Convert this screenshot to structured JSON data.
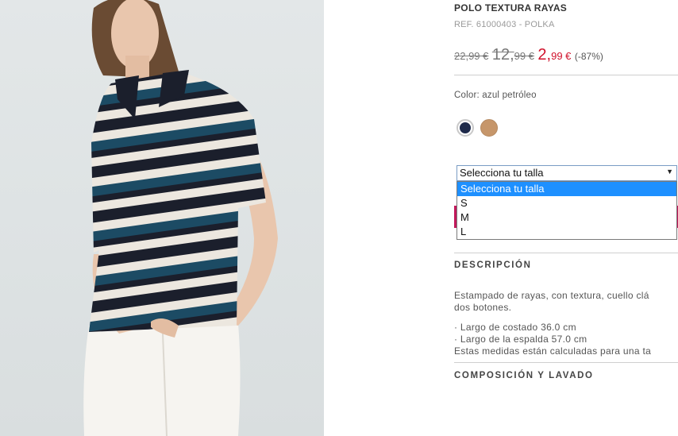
{
  "product": {
    "title": "POLO TEXTURA RAYAS",
    "ref": "REF. 61000403 - POLKA"
  },
  "price": {
    "original": "22,99 €",
    "previous_int": "12,",
    "previous_dec": "99 €",
    "current_int": "2,",
    "current_dec": "99 €",
    "discount": "(-87%)",
    "sale_color": "#d0112b"
  },
  "color": {
    "label": "Color: azul petróleo",
    "swatches": [
      {
        "name": "navy",
        "hex": "#1e2a4a",
        "selected": true
      },
      {
        "name": "camel",
        "hex": "#c6966a",
        "selected": false
      }
    ]
  },
  "size": {
    "selected_value": "Selecciona tu talla",
    "options": [
      "Selecciona tu talla",
      "S",
      "M",
      "L"
    ]
  },
  "description": {
    "title": "DESCRIPCIÓN",
    "text_line1": "Estampado de rayas, con textura, cuello clá",
    "text_line2": "dos botones.",
    "measure1": "· Largo de costado 36.0 cm",
    "measure2": "· Largo de la espalda 57.0 cm",
    "measure_note": "Estas medidas están calculadas para una ta"
  },
  "composition": {
    "title": "COMPOSICIÓN Y LAVADO"
  }
}
